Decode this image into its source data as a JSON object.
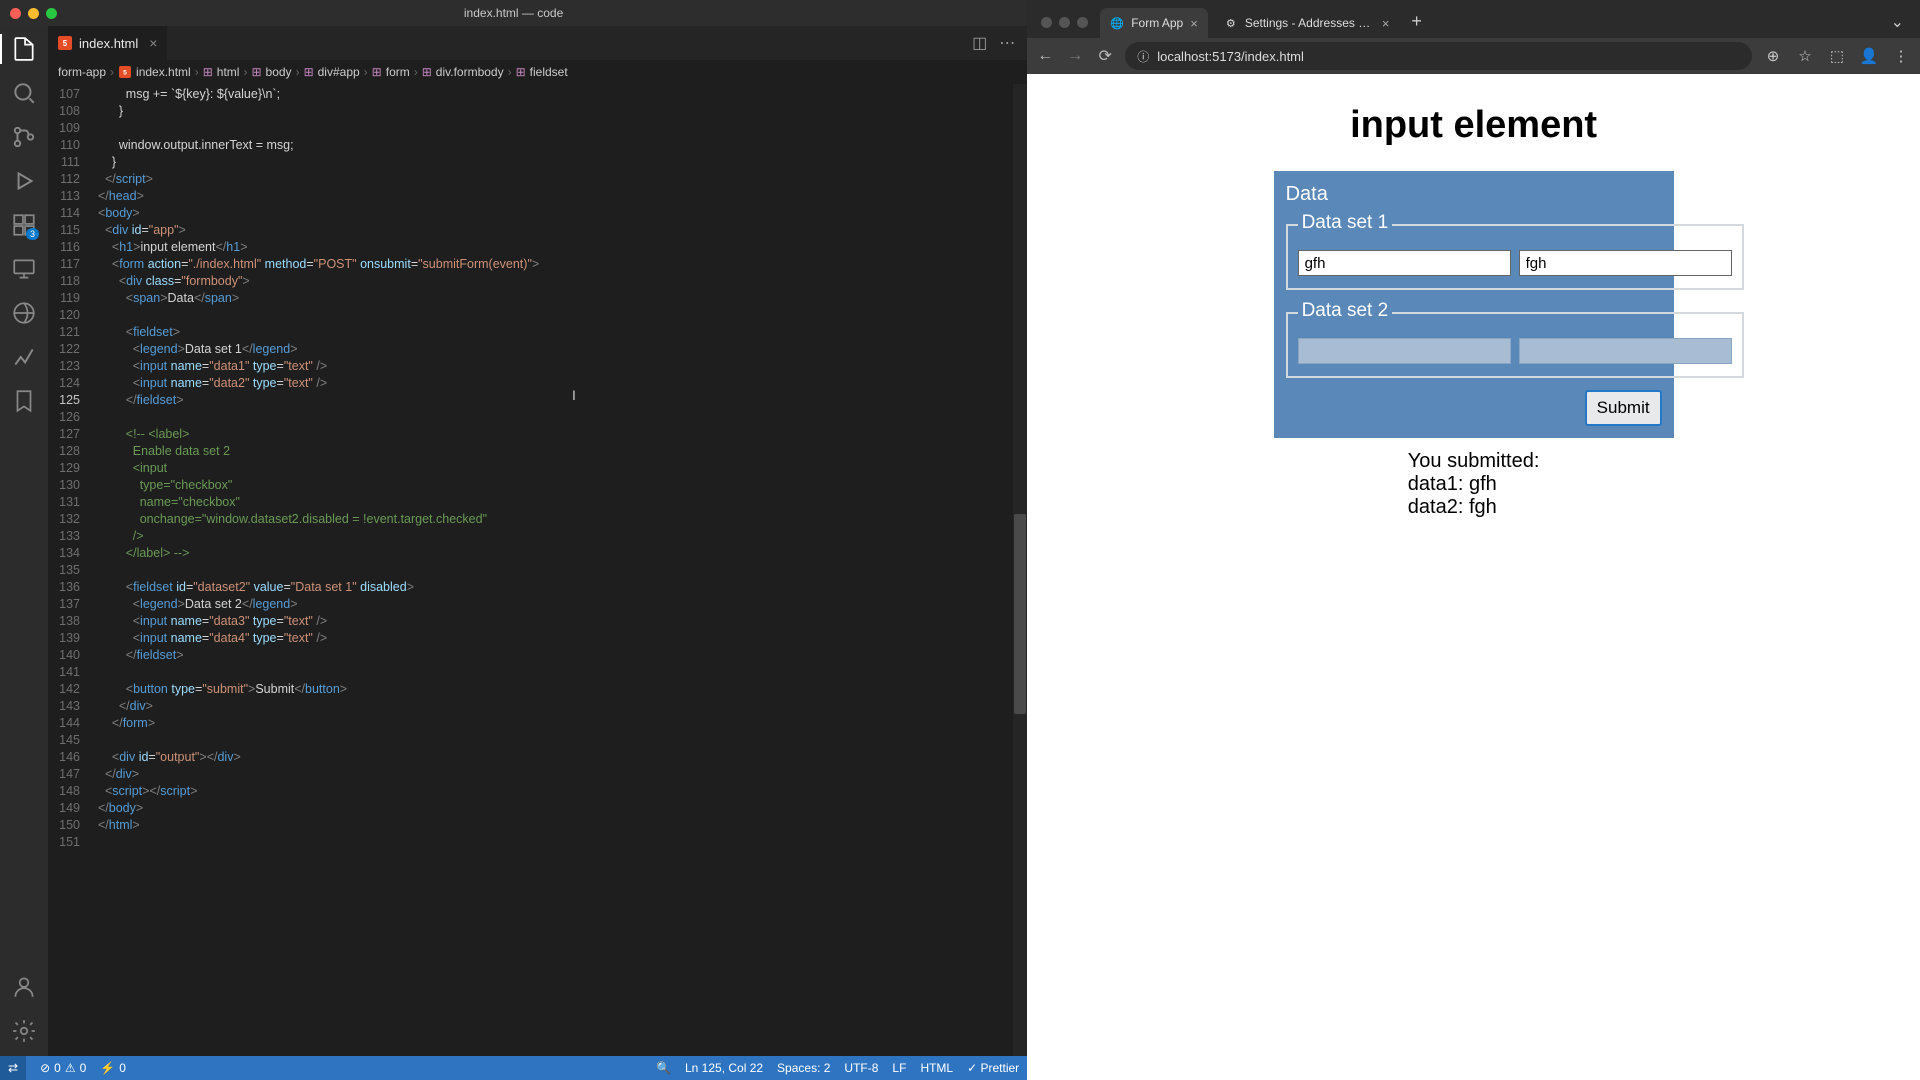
{
  "window_title": "index.html — code",
  "tab_filename": "index.html",
  "breadcrumb": [
    "form-app",
    "index.html",
    "html",
    "body",
    "div#app",
    "form",
    "div.formbody",
    "fieldset"
  ],
  "activity_badge": "3",
  "code_lines": [
    {
      "n": 107,
      "html": "        msg += `${key}: ${value}\\n`;"
    },
    {
      "n": 108,
      "html": "      }"
    },
    {
      "n": 109,
      "html": ""
    },
    {
      "n": 110,
      "html": "      window.output.innerText = msg;"
    },
    {
      "n": 111,
      "html": "    }"
    },
    {
      "n": 112,
      "html": "  </script_>"
    },
    {
      "n": 113,
      "html": "</head>"
    },
    {
      "n": 114,
      "html": "<body>"
    },
    {
      "n": 115,
      "html": "  <div id=\"app\">"
    },
    {
      "n": 116,
      "html": "    <h1>input element</h1>"
    },
    {
      "n": 117,
      "html": "    <form action=\"./index.html\" method=\"POST\" onsubmit=\"submitForm(event)\">"
    },
    {
      "n": 118,
      "html": "      <div class=\"formbody\">"
    },
    {
      "n": 119,
      "html": "        <span>Data</span>"
    },
    {
      "n": 120,
      "html": ""
    },
    {
      "n": 121,
      "html": "        <fieldset>"
    },
    {
      "n": 122,
      "html": "          <legend>Data set 1</legend>"
    },
    {
      "n": 123,
      "html": "          <input name=\"data1\" type=\"text\" />"
    },
    {
      "n": 124,
      "html": "          <input name=\"data2\" type=\"text\" />"
    },
    {
      "n": 125,
      "html": "        </fieldset>",
      "active": true
    },
    {
      "n": 126,
      "html": ""
    },
    {
      "n": 127,
      "html": "        <!-- <label>"
    },
    {
      "n": 128,
      "html": "          Enable data set 2"
    },
    {
      "n": 129,
      "html": "          <input"
    },
    {
      "n": 130,
      "html": "            type=\"checkbox\""
    },
    {
      "n": 131,
      "html": "            name=\"checkbox\""
    },
    {
      "n": 132,
      "html": "            onchange=\"window.dataset2.disabled = !event.target.checked\""
    },
    {
      "n": 133,
      "html": "          />"
    },
    {
      "n": 134,
      "html": "        </label> -->"
    },
    {
      "n": 135,
      "html": ""
    },
    {
      "n": 136,
      "html": "        <fieldset id=\"dataset2\" value=\"Data set 1\" disabled>"
    },
    {
      "n": 137,
      "html": "          <legend>Data set 2</legend>"
    },
    {
      "n": 138,
      "html": "          <input name=\"data3\" type=\"text\" />"
    },
    {
      "n": 139,
      "html": "          <input name=\"data4\" type=\"text\" />"
    },
    {
      "n": 140,
      "html": "        </fieldset>"
    },
    {
      "n": 141,
      "html": ""
    },
    {
      "n": 142,
      "html": "        <button type=\"submit\">Submit</button>"
    },
    {
      "n": 143,
      "html": "      </div>"
    },
    {
      "n": 144,
      "html": "    </form>"
    },
    {
      "n": 145,
      "html": ""
    },
    {
      "n": 146,
      "html": "    <div id=\"output\"></div>"
    },
    {
      "n": 147,
      "html": "  </div>"
    },
    {
      "n": 148,
      "html": "  <script_></script_>"
    },
    {
      "n": 149,
      "html": "</body>"
    },
    {
      "n": 150,
      "html": "</html>"
    },
    {
      "n": 151,
      "html": ""
    }
  ],
  "status": {
    "errors": "0",
    "warnings": "0",
    "port": "0",
    "cursor": "Ln 125, Col 22",
    "spaces": "Spaces: 2",
    "encoding": "UTF-8",
    "eol": "LF",
    "lang": "HTML",
    "formatter": "Prettier"
  },
  "browser": {
    "tabs": [
      {
        "title": "Form App",
        "icon": "🌐"
      },
      {
        "title": "Settings - Addresses and m…",
        "icon": "⚙"
      }
    ],
    "url": "localhost:5173/index.html"
  },
  "page": {
    "heading": "input element",
    "form_title": "Data",
    "set1": {
      "legend": "Data set 1",
      "v1": "gfh",
      "v2": "fgh"
    },
    "set2": {
      "legend": "Data set 2"
    },
    "submit": "Submit",
    "output": {
      "title": "You submitted:",
      "l1": "data1: gfh",
      "l2": "data2: fgh"
    }
  }
}
